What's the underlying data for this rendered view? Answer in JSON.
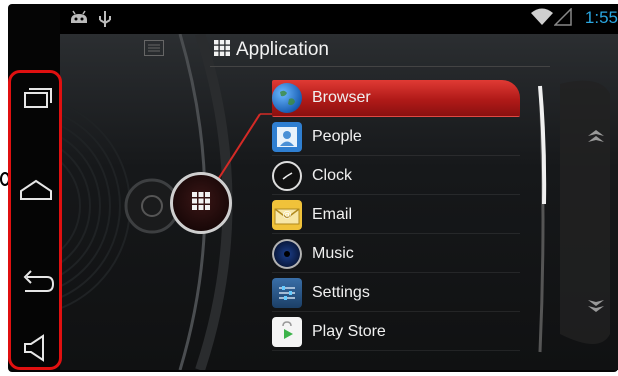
{
  "status_bar": {
    "time": "1:55",
    "left_icons": [
      "android-debug-icon",
      "usb-icon"
    ],
    "right_icons": [
      "wifi-icon",
      "signal-icon"
    ]
  },
  "header": {
    "title": "Application",
    "title_icon": "grid-icon",
    "left_icon": "menu-list-icon"
  },
  "apps": [
    {
      "label": "Browser",
      "icon": "globe-icon",
      "selected": true
    },
    {
      "label": "People",
      "icon": "contacts-icon",
      "selected": false
    },
    {
      "label": "Clock",
      "icon": "clock-icon",
      "selected": false
    },
    {
      "label": "Email",
      "icon": "email-icon",
      "selected": false
    },
    {
      "label": "Music",
      "icon": "music-icon",
      "selected": false
    },
    {
      "label": "Settings",
      "icon": "settings-icon",
      "selected": false
    },
    {
      "label": "Play Store",
      "icon": "play-store-icon",
      "selected": false
    }
  ],
  "nav_buttons": [
    "recent-apps-icon",
    "home-icon",
    "back-icon",
    "volume-icon"
  ],
  "colors": {
    "accent": "#2aa6e0",
    "highlight": "#d42a26",
    "nav_outline": "#e01010"
  }
}
